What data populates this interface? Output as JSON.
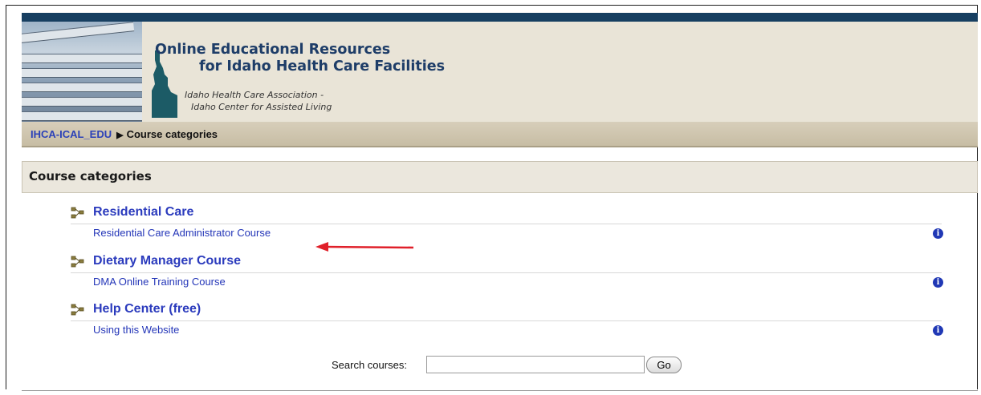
{
  "banner": {
    "title_line1": "Online Educational Resources",
    "title_line2": "for Idaho Health Care Facilities",
    "subtitle_line1": "Idaho Health Care Association -",
    "subtitle_line2": "Idaho Center for Assisted Living"
  },
  "breadcrumb": {
    "home_label": "IHCA-ICAL_EDU",
    "separator": "▶",
    "current_label": "Course categories"
  },
  "section": {
    "title": "Course categories"
  },
  "categories": [
    {
      "name": "Residential Care",
      "courses": [
        {
          "name": "Residential Care Administrator Course",
          "info_icon": "info-icon"
        }
      ]
    },
    {
      "name": "Dietary Manager Course",
      "courses": [
        {
          "name": "DMA Online Training Course",
          "info_icon": "info-icon"
        }
      ]
    },
    {
      "name": "Help Center (free)",
      "courses": [
        {
          "name": "Using this Website",
          "info_icon": "info-icon"
        }
      ]
    }
  ],
  "search": {
    "label": "Search courses:",
    "value": "",
    "button_label": "Go"
  },
  "info_glyph": "i",
  "colors": {
    "link": "#2b3bbd",
    "top_bar": "#173f61",
    "banner_bg": "#e9e4d7",
    "breadcrumb_bg": "#cfc6b0",
    "annotation_arrow": "#e0202a"
  }
}
